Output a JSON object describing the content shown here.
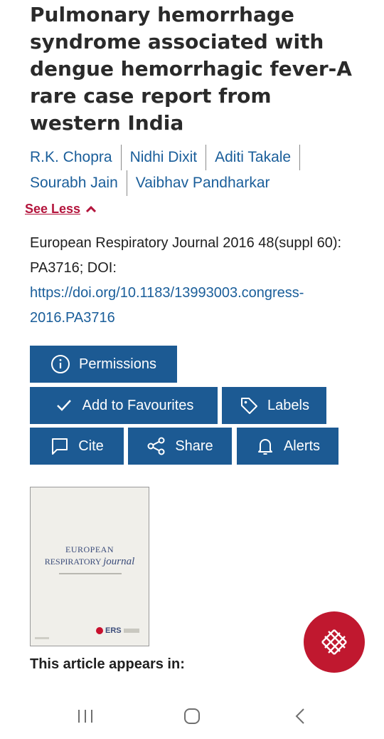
{
  "article": {
    "title": "Pulmonary hemorrhage syndrome associated with dengue hemorrhagic fever-A rare case report from western India",
    "authors_row1": [
      "R.K. Chopra",
      "Nidhi Dixit",
      "Aditi Takale"
    ],
    "authors_row2": [
      "Sourabh Jain",
      "Vaibhav Pandharkar"
    ],
    "see_less_label": "See Less",
    "citation_text": "European Respiratory Journal 2016 48(suppl 60): PA3716; DOI: ",
    "doi_link": "https://doi.org/10.1183/13993003.congress-2016.PA3716"
  },
  "actions": {
    "permissions": "Permissions",
    "add_to_favourites": "Add to Favourites",
    "labels": "Labels",
    "cite": "Cite",
    "share": "Share",
    "alerts": "Alerts"
  },
  "cover": {
    "line1": "EUROPEAN",
    "line2a": "RESPIRATORY ",
    "line2b": "journal",
    "logo_text": "ERS"
  },
  "appears_in_label": "This article appears in:",
  "colors": {
    "button_blue": "#1c5a93",
    "link_blue": "#1a5e9a",
    "accent_red": "#b3143c",
    "fab_red": "#c0182f"
  },
  "icons": {
    "permissions": "info-icon",
    "favourites": "checkmark-icon",
    "labels": "tag-icon",
    "cite": "comment-icon",
    "share": "share-icon",
    "alerts": "bell-icon",
    "see_less": "chevron-up-icon",
    "fab": "network-globe-icon",
    "nav_recent": "recent-apps-icon",
    "nav_home": "home-icon",
    "nav_back": "back-icon"
  }
}
